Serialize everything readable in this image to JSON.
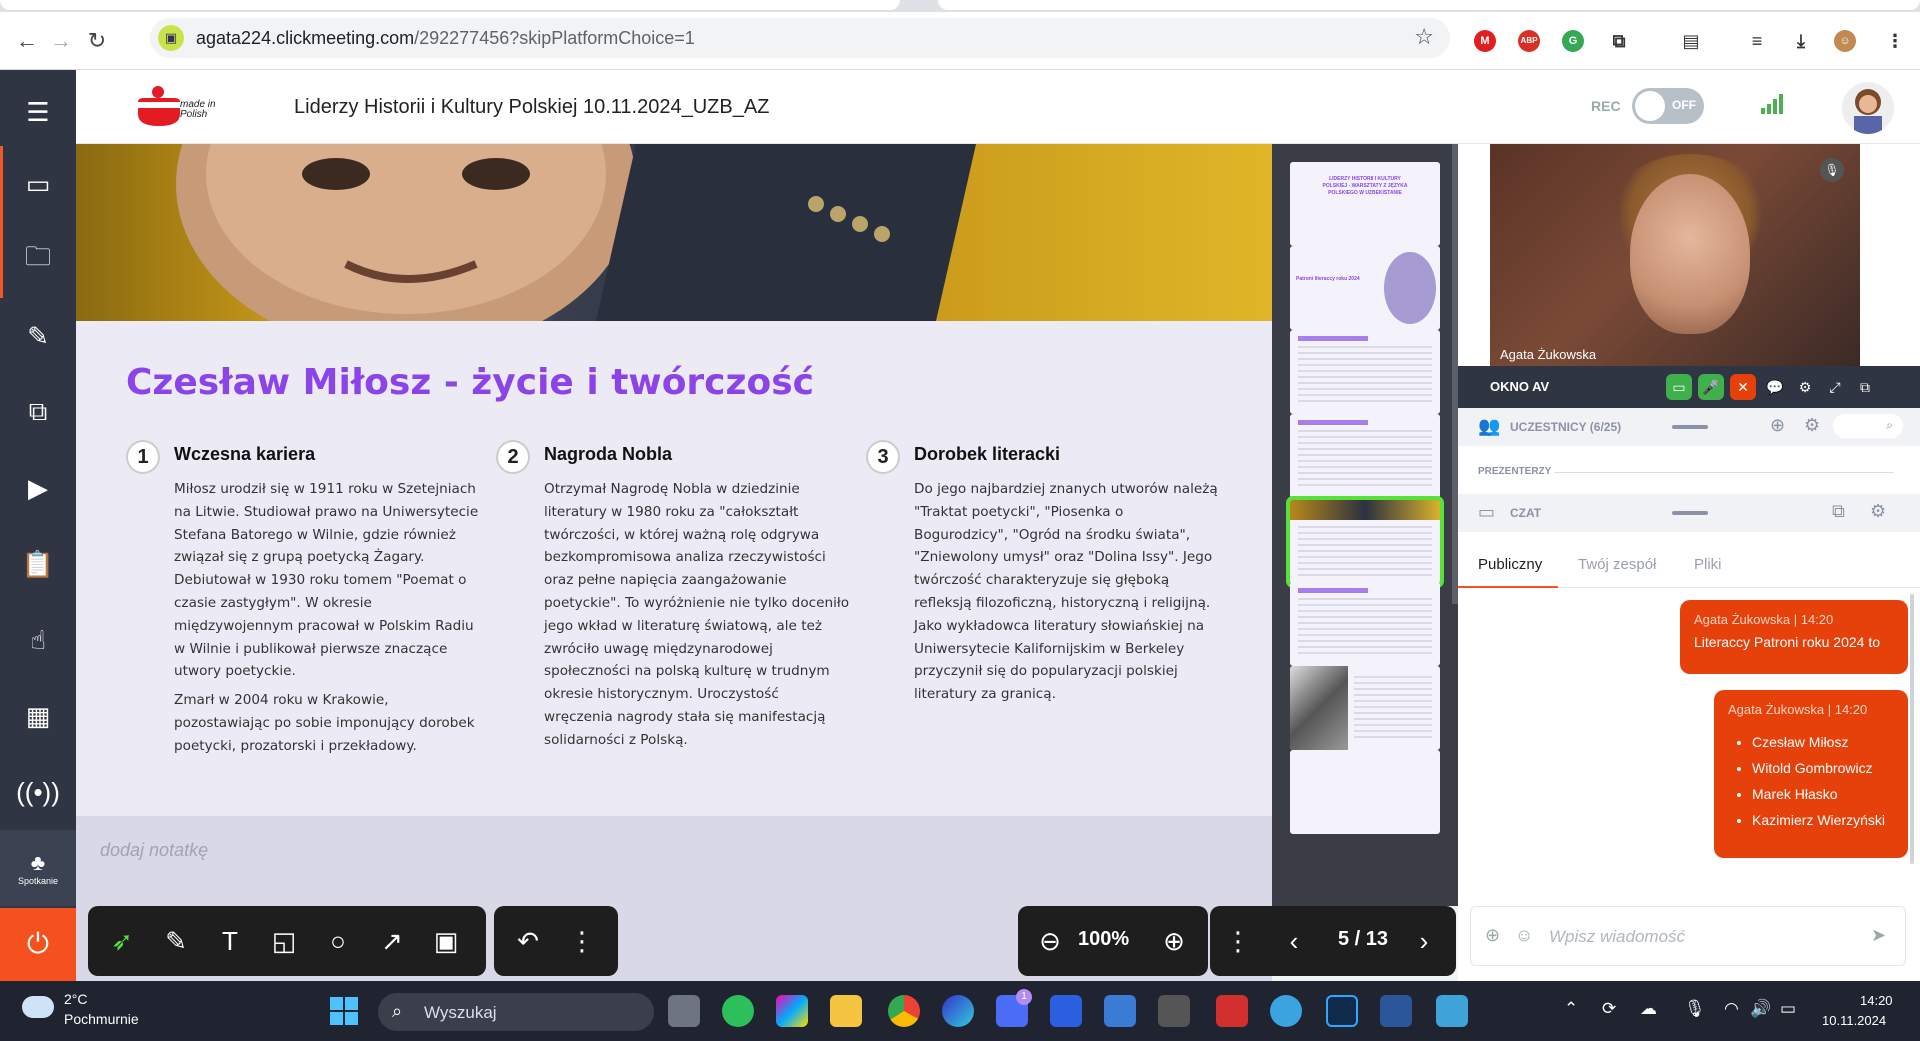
{
  "browser": {
    "url_host": "agata224.clickmeeting.com",
    "url_path": "/292277456?skipPlatformChoice=1"
  },
  "sidebar": {
    "meeting_label": "Spotkanie"
  },
  "header": {
    "title": "Liderzy Historii i Kultury Polskiej 10.11.2024_UZB_AZ",
    "rec_label": "REC",
    "rec_state": "OFF",
    "logo_text": "made in Polish"
  },
  "slide": {
    "title": "Czesław Miłosz - życie i twórczość",
    "columns": [
      {
        "number": "1",
        "heading": "Wczesna kariera",
        "paragraphs": [
          "Miłosz urodził się w 1911 roku w Szetejniach na Litwie. Studiował prawo na Uniwersytecie Stefana Batorego w Wilnie, gdzie również związał się z grupą poetycką Żagary. Debiutował w 1930 roku tomem \"Poemat o czasie zastygłym\". W okresie międzywojennym pracował w Polskim Radiu w Wilnie i publikował pierwsze znaczące utwory poetyckie.",
          "Zmarł w 2004 roku w Krakowie, pozostawiając po sobie imponujący dorobek poetycki, prozatorski i przekładowy."
        ]
      },
      {
        "number": "2",
        "heading": "Nagroda Nobla",
        "paragraphs": [
          "Otrzymał Nagrodę Nobla w dziedzinie literatury w 1980 roku za \"całokształt twórczości, w której ważną rolę odgrywa bezkompromisowa analiza rzeczywistości oraz pełne napięcia zaangażowanie poetyckie\". To wyróżnienie nie tylko doceniło jego wkład w literaturę światową, ale też zwróciło uwagę międzynarodowej społeczności na polską kulturę w trudnym okresie historycznym. Uroczystość wręczenia nagrody stała się manifestacją solidarności z Polską."
        ]
      },
      {
        "number": "3",
        "heading": "Dorobek literacki",
        "paragraphs": [
          "Do jego najbardziej znanych utworów należą \"Traktat poetycki\", \"Piosenka o Bogurodzicy\", \"Ogród na środku świata\", \"Zniewolony umysł\" oraz \"Dolina Issy\". Jego twórczość charakteryzuje się głęboką refleksją filozoficzną, historyczną i religijną. Jako wykładowca literatury słowiańskiej na Uniwersytecie Kalifornijskim w Berkeley przyczynił się do popularyzacji polskiej literatury za granicą."
        ]
      }
    ],
    "note_placeholder": "dodaj notatkę"
  },
  "thumbnails": {
    "first_text": "LIDERZY HISTORII I KULTURY POLSKIEJ - WARSZTATY Z JĘZYKA POLSKIEGO W UZBEKISTANIE",
    "second_text": "Patroni literaccy roku 2024"
  },
  "toolbar": {
    "zoom": "100%",
    "page": "5 / 13"
  },
  "av": {
    "presenter_name": "Agata Żukowska",
    "title": "OKNO AV"
  },
  "panel": {
    "participants_label": "UCZESTNICY (6/25)",
    "presenters_label": "PREZENTERZY",
    "chat_label": "CZAT",
    "tabs": [
      "Publiczny",
      "Twój zespół",
      "Pliki"
    ],
    "messages": [
      {
        "author": "Agata Żukowska",
        "time": "14:20",
        "text": "Literaccy Patroni roku 2024 to"
      },
      {
        "author": "Agata Żukowska",
        "time": "14:20",
        "items": [
          "Czesław Miłosz",
          "Witold Gombrowicz",
          "Marek Hłasko",
          "Kazimierz Wierzyński"
        ]
      }
    ],
    "input_placeholder": "Wpisz wiadomość"
  },
  "taskbar": {
    "temp": "2°C",
    "weather": "Pochmurnie",
    "search": "Wyszukaj",
    "time": "14:20",
    "date": "10.11.2024",
    "store_badge": "1"
  }
}
